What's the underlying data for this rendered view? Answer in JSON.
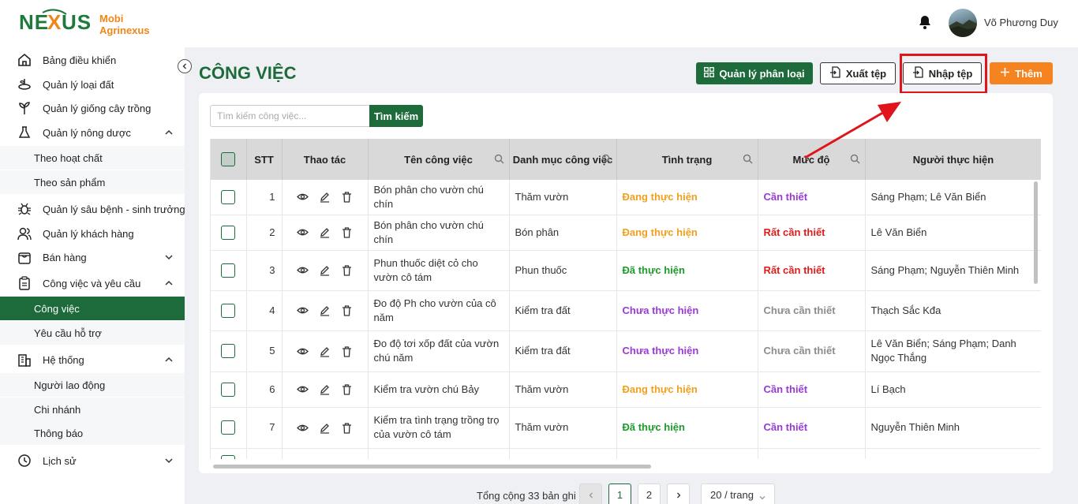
{
  "app": {
    "logo_text": "NEXUS",
    "brand_line1": "Mobi",
    "brand_line2": "Agrinexus"
  },
  "user": {
    "name": "Võ Phương Duy"
  },
  "sidebar": {
    "items": [
      {
        "label": "Bảng điều khiển",
        "icon": "dashboard-icon"
      },
      {
        "label": "Quản lý loại đất",
        "icon": "soil-icon"
      },
      {
        "label": "Quản lý giống cây trồng",
        "icon": "plant-icon"
      },
      {
        "label": "Quản lý nông dược",
        "icon": "flask-icon"
      },
      {
        "label": "Theo hoạt chất"
      },
      {
        "label": "Theo sản phẩm"
      },
      {
        "label": "Quản lý sâu bệnh - sinh trưởng",
        "icon": "bug-icon"
      },
      {
        "label": "Quản lý khách hàng",
        "icon": "users-icon"
      },
      {
        "label": "Bán hàng",
        "icon": "shopping-bag-icon"
      },
      {
        "label": "Công việc và yêu cầu",
        "icon": "clipboard-icon"
      },
      {
        "label": "Công việc"
      },
      {
        "label": "Yêu cầu hỗ trợ"
      },
      {
        "label": "Hệ thống",
        "icon": "building-icon"
      },
      {
        "label": "Người lao động"
      },
      {
        "label": "Chi nhánh"
      },
      {
        "label": "Thông báo"
      },
      {
        "label": "Lịch sử",
        "icon": "history-icon"
      }
    ]
  },
  "main": {
    "title": "CÔNG VIỆC",
    "buttons": {
      "categories": "Quản lý phân loại",
      "export": "Xuất tệp",
      "import": "Nhập tệp",
      "add": "Thêm"
    },
    "search": {
      "placeholder": "Tìm kiếm công việc...",
      "button": "Tìm kiếm"
    }
  },
  "table": {
    "columns": [
      "STT",
      "Thao tác",
      "Tên công việc",
      "Danh mục công việc",
      "Tình trạng",
      "Mức độ",
      "Người thực hiện"
    ],
    "rows": [
      {
        "stt": "1",
        "name": "Bón phân cho vườn chú chín",
        "category": "Thăm vườn",
        "status": "Đang thực hiện",
        "level": "Cần thiết",
        "assignee": "Sáng Phạm; Lê  Văn Biển"
      },
      {
        "stt": "2",
        "name": "Bón phân cho vườn chú chín",
        "category": "Bón phân",
        "status": "Đang thực hiện",
        "level": "Rất cần thiết",
        "assignee": "Lê  Văn Biển"
      },
      {
        "stt": "3",
        "name": "Phun thuốc diệt cỏ cho vườn cô tám",
        "category": "Phun thuốc",
        "status": "Đã thực hiện",
        "level": "Rất cần thiết",
        "assignee": "Sáng Phạm; Nguyễn  Thiên Minh"
      },
      {
        "stt": "4",
        "name": "Đo độ Ph cho vườn của cô năm",
        "category": "Kiểm tra đất",
        "status": "Chưa thực hiện",
        "level": "Chưa cần thiết",
        "assignee": "Thạch Sắc Kđa"
      },
      {
        "stt": "5",
        "name": "Đo độ tơi xốp đất của vườn chú năm",
        "category": "Kiểm tra đất",
        "status": "Chưa thực hiện",
        "level": "Chưa cần thiết",
        "assignee": "Lê  Văn Biển; Sáng Phạm; Danh  Ngọc Thắng"
      },
      {
        "stt": "6",
        "name": "Kiểm tra vườn chú Bảy",
        "category": "Thăm vườn",
        "status": "Đang thực hiện",
        "level": "Cần thiết",
        "assignee": "Lí  Bạch"
      },
      {
        "stt": "7",
        "name": "Kiểm tra tình trạng trồng trọ của vườn cô tám",
        "category": "Thăm vườn",
        "status": "Đã thực hiện",
        "level": "Cần thiết",
        "assignee": "Nguyễn  Thiên Minh"
      }
    ]
  },
  "colors": {
    "status": {
      "Đang thực hiện": "#f0a01e",
      "Đã thực hiện": "#1c9a2c",
      "Chưa thực hiện": "#9a3ad6"
    },
    "level": {
      "Cần thiết": "#9a3ad6",
      "Rất cần thiết": "#e01b1b",
      "Chưa cần thiết": "#8c8c8c"
    }
  },
  "pagination": {
    "total": "Tổng cộng 33 bản ghi",
    "pages": [
      "1",
      "2"
    ],
    "current": "1",
    "page_size": "20 / trang"
  }
}
